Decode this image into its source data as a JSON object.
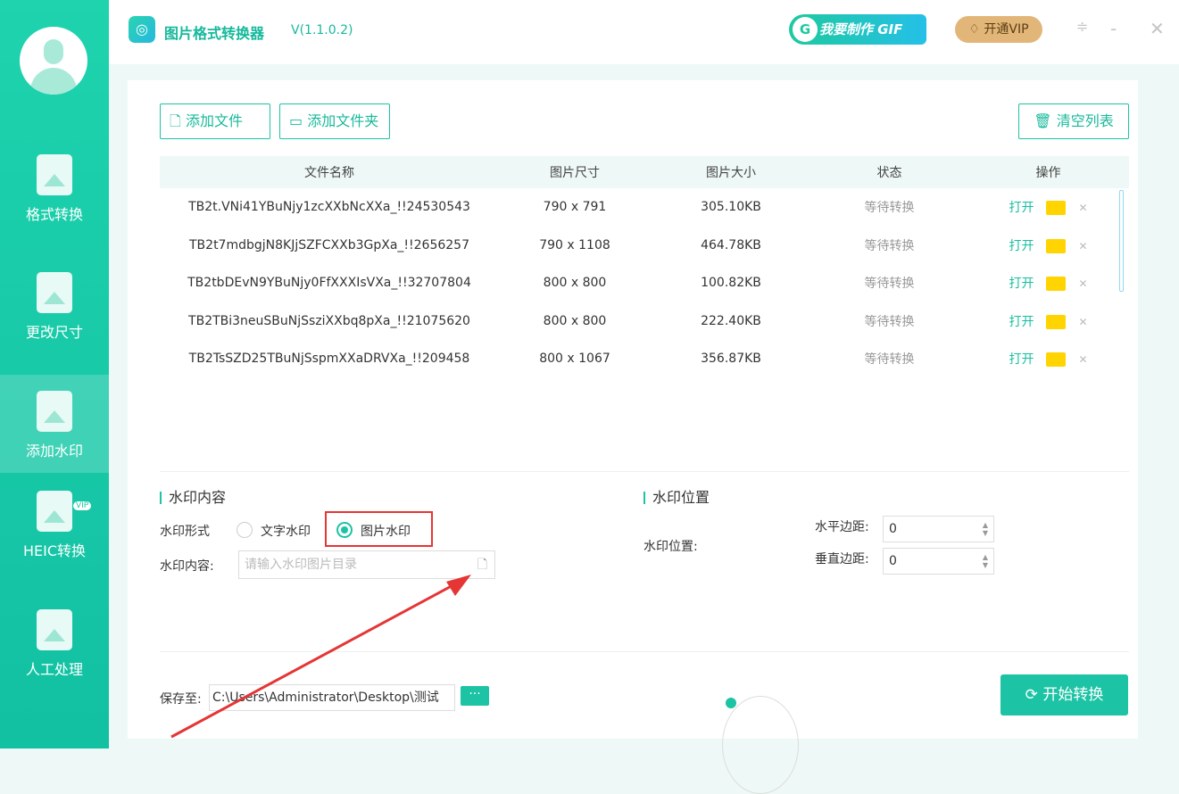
{
  "app": {
    "title": "图片格式转换器",
    "version": "V(1.1.0.2)",
    "gif_button": "我要制作 GIF",
    "vip_button": "开通VIP"
  },
  "sidebar": {
    "items": [
      {
        "label": "格式转换"
      },
      {
        "label": "更改尺寸"
      },
      {
        "label": "添加水印",
        "active": true
      },
      {
        "label": "HEIC转换",
        "badge": "VIP"
      },
      {
        "label": "人工处理"
      }
    ]
  },
  "toolbar": {
    "add_file": "添加文件",
    "add_folder": "添加文件夹",
    "clear_list": "清空列表"
  },
  "table": {
    "headers": [
      "文件名称",
      "图片尺寸",
      "图片大小",
      "状态",
      "操作"
    ],
    "rows": [
      {
        "name": "TB2t.VNi41YBuNjy1zcXXbNcXXa_!!24530543",
        "size": "790 x 791",
        "filesize": "305.10KB",
        "status": "等待转换",
        "open": "打开"
      },
      {
        "name": "TB2t7mdbgjN8KJjSZFCXXb3GpXa_!!2656257",
        "size": "790 x 1108",
        "filesize": "464.78KB",
        "status": "等待转换",
        "open": "打开"
      },
      {
        "name": "TB2tbDEvN9YBuNjy0FfXXXIsVXa_!!32707804",
        "size": "800 x 800",
        "filesize": "100.82KB",
        "status": "等待转换",
        "open": "打开"
      },
      {
        "name": "TB2TBi3neuSBuNjSsziXXbq8pXa_!!21075620",
        "size": "800 x 800",
        "filesize": "222.40KB",
        "status": "等待转换",
        "open": "打开"
      },
      {
        "name": "TB2TsSZD25TBuNjSspmXXaDRVXa_!!209458",
        "size": "800 x 1067",
        "filesize": "356.87KB",
        "status": "等待转换",
        "open": "打开"
      }
    ]
  },
  "watermark": {
    "content_title": "水印内容",
    "form_label": "水印形式",
    "text_option": "文字水印",
    "image_option": "图片水印",
    "content_label": "水印内容:",
    "content_placeholder": "请输入水印图片目录",
    "position_title": "水印位置",
    "position_label": "水印位置:",
    "h_margin_label": "水平边距:",
    "h_margin": "0",
    "v_margin_label": "垂直边距:",
    "v_margin": "0"
  },
  "footer": {
    "save_label": "保存至:",
    "save_path": "C:\\Users\\Administrator\\Desktop\\测试",
    "browse": "···",
    "start": "开始转换"
  },
  "colors": {
    "accent": "#1cc3a4",
    "highlight": "#e53535"
  }
}
